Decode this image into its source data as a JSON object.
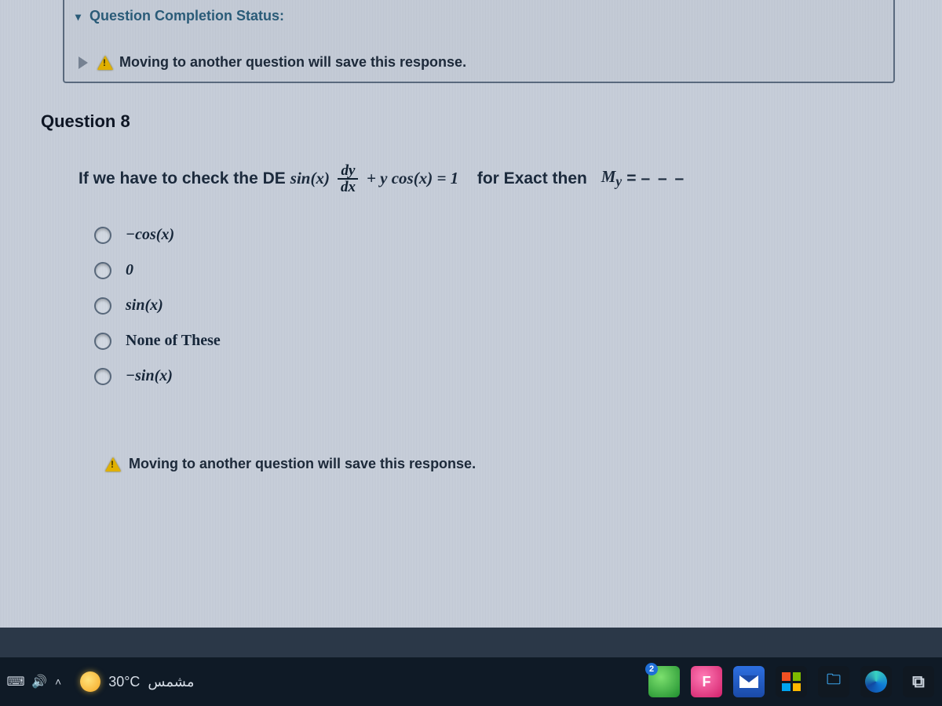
{
  "status_header": "Question Completion Status:",
  "move_warning": "Moving to another question will save this response.",
  "question": {
    "title": "Question 8",
    "prompt_before": "If we have to check the DE",
    "eq_sinx": "sin(x)",
    "frac_num": "dy",
    "frac_den": "dx",
    "eq_after_frac": "+ y cos(x) = 1",
    "prompt_after": "for Exact then",
    "my_expr": "M",
    "my_sub": "y",
    "equals": " = ",
    "dashes": "– – –"
  },
  "options": [
    "−cos(x)",
    "0",
    "sin(x)",
    "None of These",
    "−sin(x)"
  ],
  "bottom_warning": "Moving to another question will save this response.",
  "taskbar": {
    "weather_temp": "30°C",
    "weather_label": "مشمس",
    "pink_letter": "F"
  }
}
